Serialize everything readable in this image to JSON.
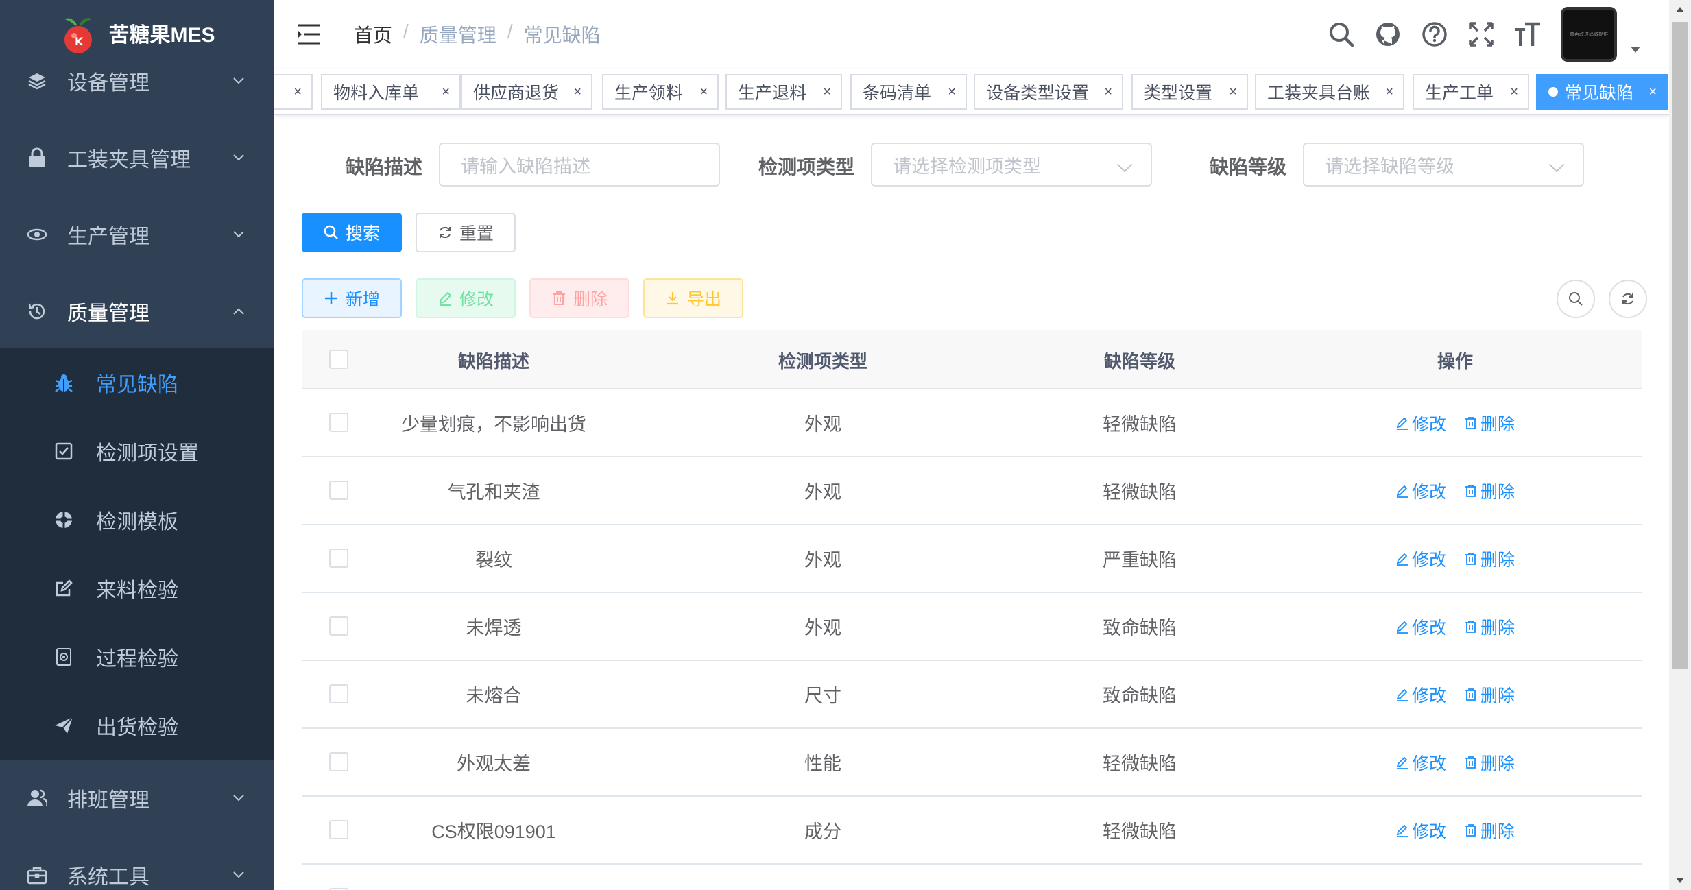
{
  "app": {
    "title": "苦糖果MES",
    "accent": "#409eff",
    "sidebar_bg": "#304156",
    "submenu_bg": "#1f2d3d"
  },
  "sidebar": {
    "menus": [
      {
        "label": "设备管理",
        "icon": "layers-icon",
        "expanded": false
      },
      {
        "label": "工装夹具管理",
        "icon": "lock-icon",
        "expanded": false
      },
      {
        "label": "生产管理",
        "icon": "eye-icon",
        "expanded": false
      },
      {
        "label": "质量管理",
        "icon": "history-icon",
        "expanded": true
      },
      {
        "label": "排班管理",
        "icon": "peoples-icon",
        "expanded": false
      },
      {
        "label": "系统工具",
        "icon": "toolbox-icon",
        "expanded": false
      }
    ],
    "quality_submenu": [
      {
        "label": "常见缺陷",
        "icon": "bug-icon",
        "active": true
      },
      {
        "label": "检测项设置",
        "icon": "checkbox-icon",
        "active": false
      },
      {
        "label": "检测模板",
        "icon": "template-icon",
        "active": false
      },
      {
        "label": "来料检验",
        "icon": "edit-icon",
        "active": false
      },
      {
        "label": "过程检验",
        "icon": "process-icon",
        "active": false
      },
      {
        "label": "出货检验",
        "icon": "send-icon",
        "active": false
      }
    ]
  },
  "breadcrumb": {
    "home": "首页",
    "sep": "/",
    "level1": "质量管理",
    "level2": "常见缺陷"
  },
  "navbar_icons": [
    "search-icon",
    "github-icon",
    "question-icon",
    "fullscreen-icon",
    "font-size-icon"
  ],
  "avatar": {
    "caption": "单再改进码微提供"
  },
  "tags": [
    {
      "label": "物料入库单"
    },
    {
      "label": "供应商退货"
    },
    {
      "label": "生产领料"
    },
    {
      "label": "生产退料"
    },
    {
      "label": "条码清单"
    },
    {
      "label": "设备类型设置"
    },
    {
      "label": "类型设置"
    },
    {
      "label": "工装夹具台账"
    },
    {
      "label": "生产工单"
    },
    {
      "label": "常见缺陷",
      "active": true
    }
  ],
  "tag_close": "×",
  "search_form": {
    "desc_label": "缺陷描述",
    "desc_placeholder": "请输入缺陷描述",
    "type_label": "检测项类型",
    "type_placeholder": "请选择检测项类型",
    "level_label": "缺陷等级",
    "level_placeholder": "请选择缺陷等级",
    "search_btn": "搜索",
    "reset_btn": "重置"
  },
  "toolbar": {
    "add": "新增",
    "edit": "修改",
    "delete": "删除",
    "export": "导出"
  },
  "table": {
    "headers": [
      "缺陷描述",
      "检测项类型",
      "缺陷等级",
      "操作"
    ],
    "edit_label": "修改",
    "delete_label": "删除",
    "rows": [
      {
        "desc": "少量划痕，不影响出货",
        "type": "外观",
        "level": "轻微缺陷"
      },
      {
        "desc": "气孔和夹渣",
        "type": "外观",
        "level": "轻微缺陷"
      },
      {
        "desc": "裂纹",
        "type": "外观",
        "level": "严重缺陷"
      },
      {
        "desc": "未焊透",
        "type": "外观",
        "level": "致命缺陷"
      },
      {
        "desc": "未熔合",
        "type": "尺寸",
        "level": "致命缺陷"
      },
      {
        "desc": "外观太差",
        "type": "性能",
        "level": "轻微缺陷"
      },
      {
        "desc": "CS权限091901",
        "type": "成分",
        "level": "轻微缺陷"
      }
    ]
  }
}
